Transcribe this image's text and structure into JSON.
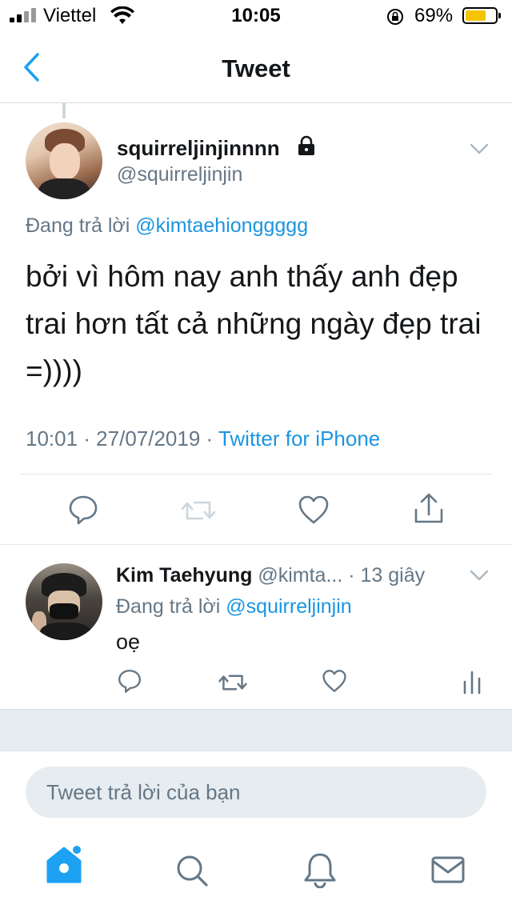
{
  "status_bar": {
    "carrier": "Viettel",
    "time": "10:05",
    "battery": "69%",
    "battery_level": 0.69
  },
  "nav": {
    "back_icon": "chevron-left-icon",
    "title": "Tweet"
  },
  "main_tweet": {
    "author_name": "squirreljinjinnnn",
    "handle": "@squirreljinjin",
    "reply_prefix": "Đang trả lời",
    "reply_to": "@kimtaehionggggg",
    "text": "bởi vì hôm nay anh thấy anh đẹp trai hơn tất cả những ngày đẹp trai =))))",
    "timestamp": "10:01 · 27/07/2019 · ",
    "source": "Twitter for iPhone",
    "actions": [
      "reply-icon",
      "retweet-icon",
      "like-icon",
      "share-icon"
    ]
  },
  "reply_tweet": {
    "author_name": "Kim Taehyung",
    "handle_time": "@kimta... · 13 giây",
    "reply_prefix": "Đang trả lời",
    "reply_to": "@squirreljinjin",
    "text": "oẹ",
    "actions": [
      "reply-icon",
      "retweet-icon",
      "like-icon",
      "analytics-icon"
    ]
  },
  "composer": {
    "placeholder": "Tweet trả lời của bạn"
  },
  "tab_bar": {
    "items": [
      "home-icon",
      "search-icon",
      "notifications-icon",
      "messages-icon"
    ]
  },
  "colors": {
    "accent": "#1da1f2",
    "link": "#1b95e0",
    "secondary_text": "#657786",
    "icon": "#657786",
    "separator": "#e6ecf0"
  }
}
